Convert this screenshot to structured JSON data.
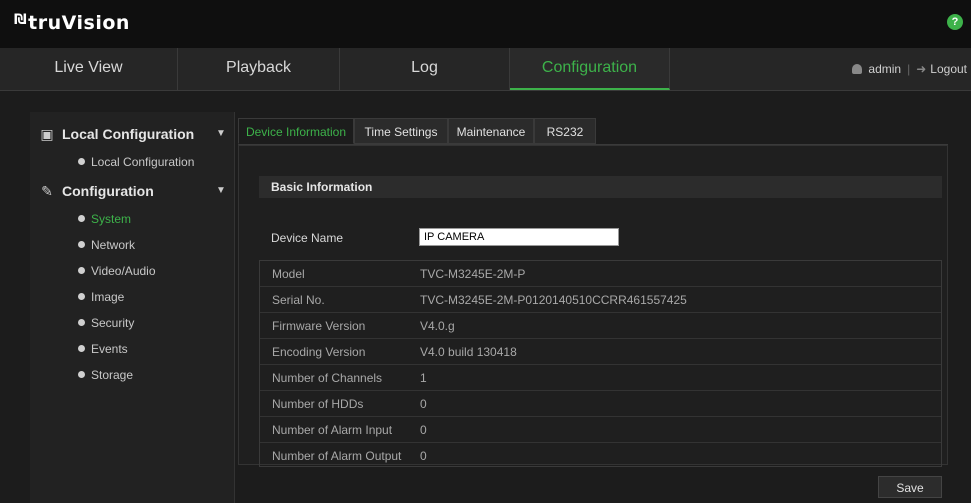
{
  "brand": {
    "mark": "₪",
    "name": "truVision"
  },
  "nav": {
    "tabs": [
      "Live View",
      "Playback",
      "Log",
      "Configuration"
    ],
    "active": "Configuration",
    "user": "admin",
    "logout": "Logout"
  },
  "sidebar": {
    "local_header": "Local Configuration",
    "local_items": [
      "Local Configuration"
    ],
    "config_header": "Configuration",
    "config_items": [
      "System",
      "Network",
      "Video/Audio",
      "Image",
      "Security",
      "Events",
      "Storage"
    ],
    "active_item": "System"
  },
  "subtabs": [
    "Device Information",
    "Time Settings",
    "Maintenance",
    "RS232"
  ],
  "active_subtab": "Device Information",
  "basic_info": {
    "title": "Basic Information",
    "device_name_label": "Device Name",
    "device_name_value": "IP CAMERA",
    "rows": [
      {
        "key": "Model",
        "value": "TVC-M3245E-2M-P"
      },
      {
        "key": "Serial No.",
        "value": "TVC-M3245E-2M-P0120140510CCRR461557425"
      },
      {
        "key": "Firmware Version",
        "value": "V4.0.g"
      },
      {
        "key": "Encoding Version",
        "value": "V4.0 build 130418"
      },
      {
        "key": "Number of Channels",
        "value": "1"
      },
      {
        "key": "Number of HDDs",
        "value": "0"
      },
      {
        "key": "Number of Alarm Input",
        "value": "0"
      },
      {
        "key": "Number of Alarm Output",
        "value": "0"
      }
    ]
  },
  "save_label": "Save",
  "colors": {
    "accent": "#3db24a",
    "background": "#1c1c1c"
  }
}
